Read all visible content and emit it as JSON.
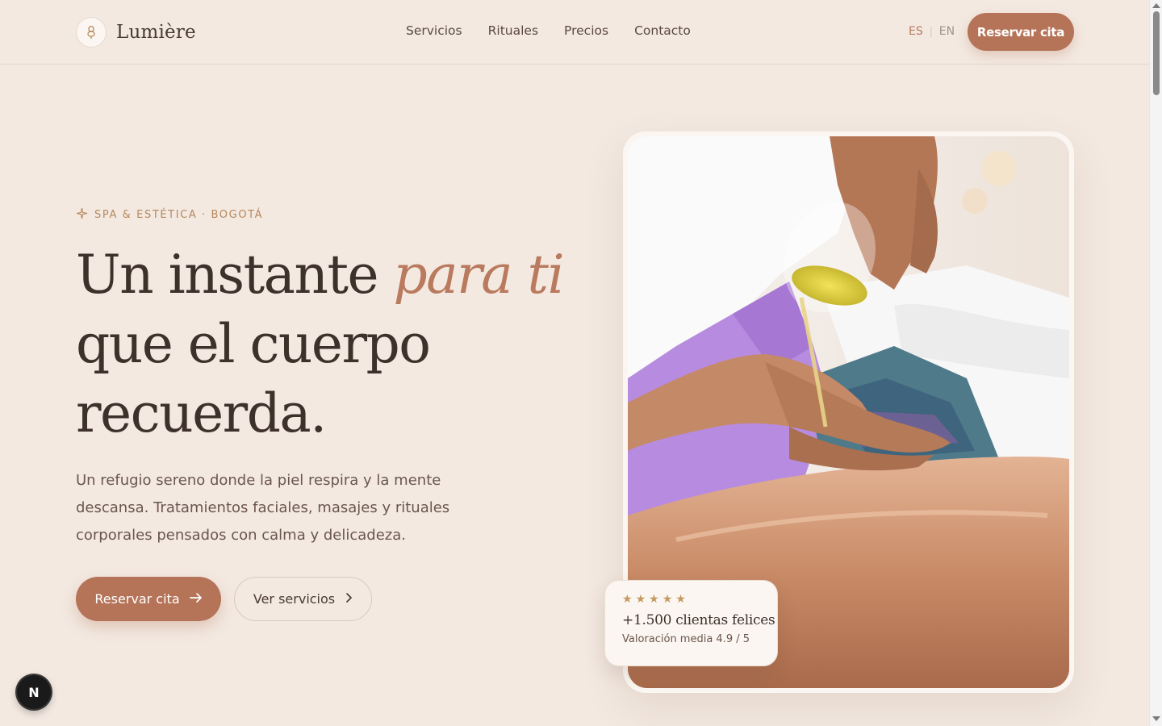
{
  "header": {
    "brand_name": "Lumière",
    "brand_icon": "lotus-icon",
    "nav": [
      "Servicios",
      "Rituales",
      "Precios",
      "Contacto"
    ],
    "lang_es": "ES",
    "lang_sep": "|",
    "lang_en": "EN",
    "cta": "Reservar cita"
  },
  "hero": {
    "eyebrow": "SPA & ESTÉTICA · BOGOTÁ",
    "eyebrow_icon": "sparkle-icon",
    "title_part1": "Un instante ",
    "title_accent": "para ti",
    "title_part2": "que el cuerpo",
    "title_part3": "recuerda.",
    "description": "Un refugio sereno donde la piel respira y la mente descansa. Tratamientos faciales, masajes y rituales corporales pensados con calma y delicadeza.",
    "primary_button": "Reservar cita",
    "primary_icon": "arrow-right-icon",
    "secondary_button": "Ver servicios",
    "secondary_icon": "chevron-right-icon"
  },
  "rating_card": {
    "stars": 5,
    "title": "+1.500 clientas felices",
    "subtitle": "Valoración media 4.9 / 5"
  },
  "colors": {
    "background": "#f3e9e1",
    "accent": "#b57358",
    "gold": "#b6885c",
    "text": "#3e302a"
  },
  "dev_badge": "N"
}
